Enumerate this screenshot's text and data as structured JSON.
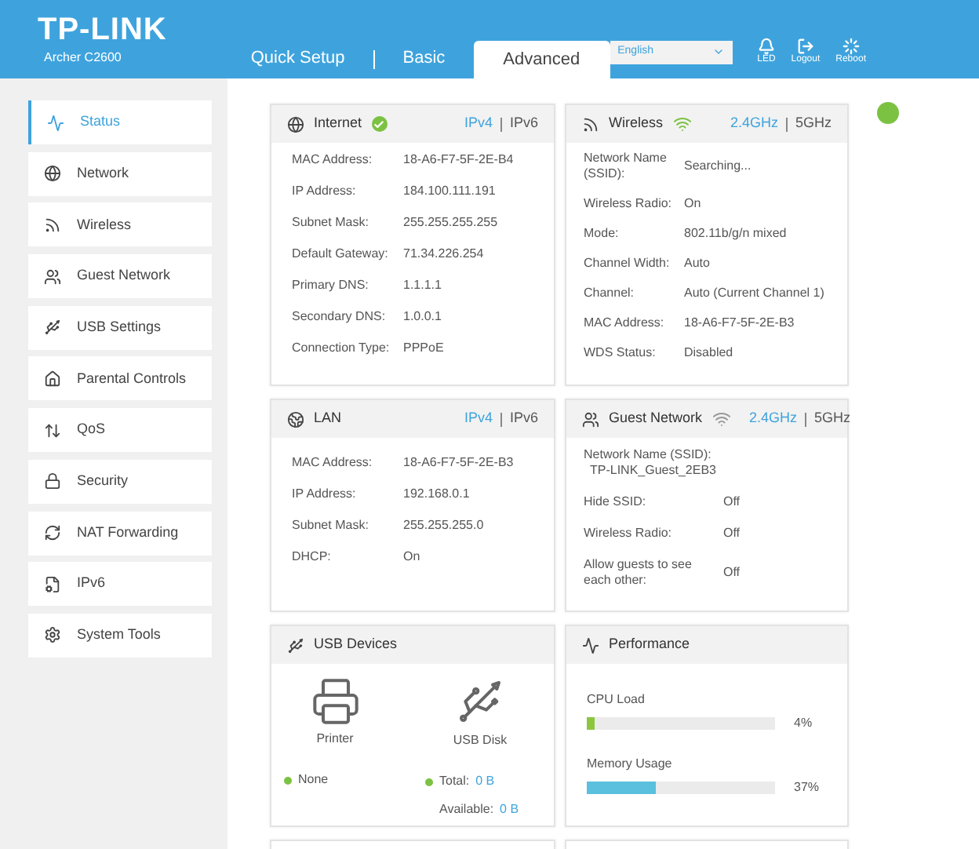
{
  "header": {
    "logo": "TP-LINK",
    "model": "Archer C2600",
    "tabs": [
      {
        "label": "Quick Setup",
        "selected": false
      },
      {
        "label": "Basic",
        "selected": false
      },
      {
        "label": "Advanced",
        "selected": true
      }
    ],
    "language": "English",
    "actions": [
      {
        "label": "LED"
      },
      {
        "label": "Logout"
      },
      {
        "label": "Reboot"
      }
    ]
  },
  "sidebar": {
    "items": [
      {
        "label": "Status",
        "selected": true
      },
      {
        "label": "Network",
        "selected": false
      },
      {
        "label": "Wireless",
        "selected": false
      },
      {
        "label": "Guest Network",
        "selected": false
      },
      {
        "label": "USB Settings",
        "selected": false
      },
      {
        "label": "Parental Controls",
        "selected": false
      },
      {
        "label": "QoS",
        "selected": false
      },
      {
        "label": "Security",
        "selected": false
      },
      {
        "label": "NAT Forwarding",
        "selected": false
      },
      {
        "label": "IPv6",
        "selected": false
      },
      {
        "label": "System Tools",
        "selected": false
      }
    ]
  },
  "panels": [
    {
      "title": "Internet",
      "connected": true,
      "switches": [
        {
          "label": "IPv4",
          "selected": true
        },
        {
          "label": "IPv6",
          "selected": false
        }
      ],
      "rows": [
        {
          "label": "MAC Address:",
          "value": "18-A6-F7-5F-2E-B4"
        },
        {
          "label": "IP Address:",
          "value": "184.100.111.191"
        },
        {
          "label": "Subnet Mask:",
          "value": "255.255.255.255"
        },
        {
          "label": "Default Gateway:",
          "value": "71.34.226.254"
        },
        {
          "label": "Primary DNS:",
          "value": "1.1.1.1"
        },
        {
          "label": "Secondary DNS:",
          "value": "1.0.0.1"
        },
        {
          "label": "Connection Type:",
          "value": "PPPoE"
        }
      ]
    },
    {
      "title": "Wireless",
      "signal_on": true,
      "switches": [
        {
          "label": "2.4GHz",
          "selected": true
        },
        {
          "label": "5GHz",
          "selected": false
        }
      ],
      "rows": [
        {
          "label": "Network Name (SSID):",
          "value": "Searching..."
        },
        {
          "label": "Wireless Radio:",
          "value": "On"
        },
        {
          "label": "Mode:",
          "value": "802.11b/g/n mixed"
        },
        {
          "label": "Channel Width:",
          "value": "Auto"
        },
        {
          "label": "Channel:",
          "value": "Auto (Current Channel 1)"
        },
        {
          "label": "MAC Address:",
          "value": "18-A6-F7-5F-2E-B3"
        },
        {
          "label": "WDS Status:",
          "value": "Disabled"
        }
      ]
    },
    {
      "title": "LAN",
      "switches": [
        {
          "label": "IPv4",
          "selected": true
        },
        {
          "label": "IPv6",
          "selected": false
        }
      ],
      "rows": [
        {
          "label": "MAC Address:",
          "value": "18-A6-F7-5F-2E-B3"
        },
        {
          "label": "IP Address:",
          "value": "192.168.0.1"
        },
        {
          "label": "Subnet Mask:",
          "value": "255.255.255.0"
        },
        {
          "label": "DHCP:",
          "value": "On"
        }
      ]
    },
    {
      "title": "Guest Network",
      "signal_on": false,
      "switches": [
        {
          "label": "2.4GHz",
          "selected": true
        },
        {
          "label": "5GHz",
          "selected": false
        }
      ],
      "ssid_label": "Network Name (SSID):",
      "ssid": "TP-LINK_Guest_2EB3",
      "rows": [
        {
          "label": "Hide SSID:",
          "value": "Off"
        },
        {
          "label": "Wireless Radio:",
          "value": "Off"
        },
        {
          "label": "Allow guests to see each other:",
          "value": "Off"
        }
      ]
    }
  ],
  "usb": {
    "title": "USB Devices",
    "printer_label": "Printer",
    "printer_status": "None",
    "disk_label": "USB Disk",
    "total_label": "Total:",
    "total": "0 B",
    "available_label": "Available:",
    "available": "0 B"
  },
  "performance": {
    "title": "Performance",
    "meters": [
      {
        "label": "CPU Load",
        "level": 0.04,
        "reading": "4%",
        "color": "#8cc63f"
      },
      {
        "label": "Memory Usage",
        "level": 0.37,
        "reading": "37%",
        "color": "#5bc0de"
      }
    ]
  }
}
